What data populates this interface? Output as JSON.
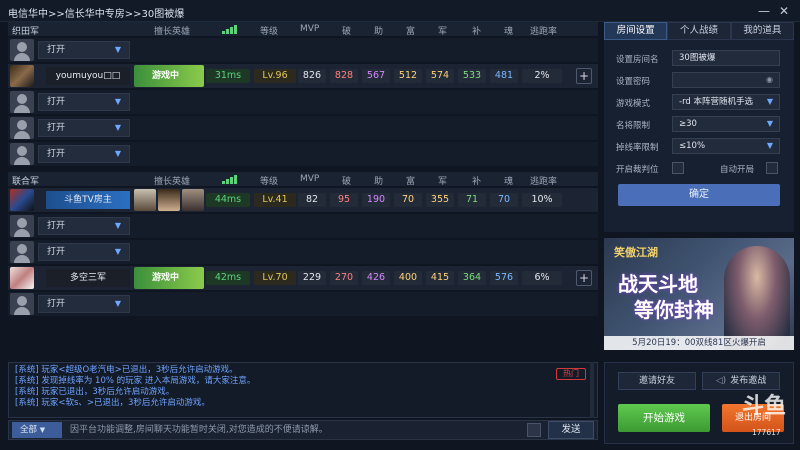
{
  "window": {
    "title": "电信华中>>信长华中专房>>30图被爆",
    "minimize": "—",
    "close": "✕"
  },
  "columns": {
    "hero": "擅长英雄",
    "level": "等级",
    "mvp": "MVP",
    "po": "破",
    "zhu": "助",
    "fu": "富",
    "jun": "军",
    "bu": "补",
    "hun": "魂",
    "escape": "逃跑率"
  },
  "team1": {
    "name": "织田军",
    "open_label": "打开",
    "player": {
      "name": "youmuyou□□",
      "hero": "游戏中",
      "ping": "31ms",
      "level": "Lv.96",
      "mvp": "826",
      "po": "828",
      "zhu": "567",
      "fu": "512",
      "jun": "574",
      "bu": "533",
      "hun": "481",
      "escape": "2%"
    }
  },
  "team2": {
    "name": "联合军",
    "open_label": "打开",
    "host": {
      "name": "斗鱼TV房主",
      "ping": "44ms",
      "level": "Lv.41",
      "mvp": "82",
      "po": "95",
      "zhu": "190",
      "fu": "70",
      "jun": "355",
      "bu": "71",
      "hun": "70",
      "escape": "10%"
    },
    "player": {
      "name": "多空三军",
      "hero": "游戏中",
      "ping": "42ms",
      "level": "Lv.70",
      "mvp": "229",
      "po": "270",
      "zhu": "426",
      "fu": "400",
      "jun": "415",
      "bu": "364",
      "hun": "576",
      "escape": "6%"
    }
  },
  "right_tabs": [
    "房间设置",
    "个人战绩",
    "我的道具"
  ],
  "settings": {
    "room_name_label": "设置房间名",
    "room_name": "30图被爆",
    "password_label": "设置密码",
    "mode_label": "游戏模式",
    "mode": "-rd 本阵营随机手选",
    "fame_label": "名将限制",
    "fame": "≥30",
    "drop_label": "掉线率限制",
    "drop": "≤10%",
    "judge_label": "开启裁判位",
    "auto_label": "自动开局",
    "confirm": "确定"
  },
  "banner": {
    "game": "笑傲江湖",
    "slogan1": "战天斗地",
    "slogan2": "等你封神",
    "footer": "5月20日19：00双线81区火爆开启"
  },
  "chat": {
    "hot": "热门",
    "lines": [
      "[系统] 玩家<超级O老汽电>已退出，3秒后允许启动游戏。",
      "[系统] 发现掉线率为 10% 的玩家 进入本局游戏，请大家注意。",
      "[系统] 玩家已退出，3秒后允许启动游戏。",
      "[系统] 玩家<软s、>已退出，3秒后允许启动游戏。"
    ],
    "channel": "全部",
    "input_placeholder": "因平台功能调整,房间聊天功能暂时关闭,对您造成的不便请谅解。",
    "send": "发送"
  },
  "actions": {
    "invite": "邀请好友",
    "broadcast": "发布邀战",
    "start": "开始游戏",
    "exit": "退出房间"
  },
  "watermark": {
    "logo": "斗鱼",
    "id": "177617"
  }
}
